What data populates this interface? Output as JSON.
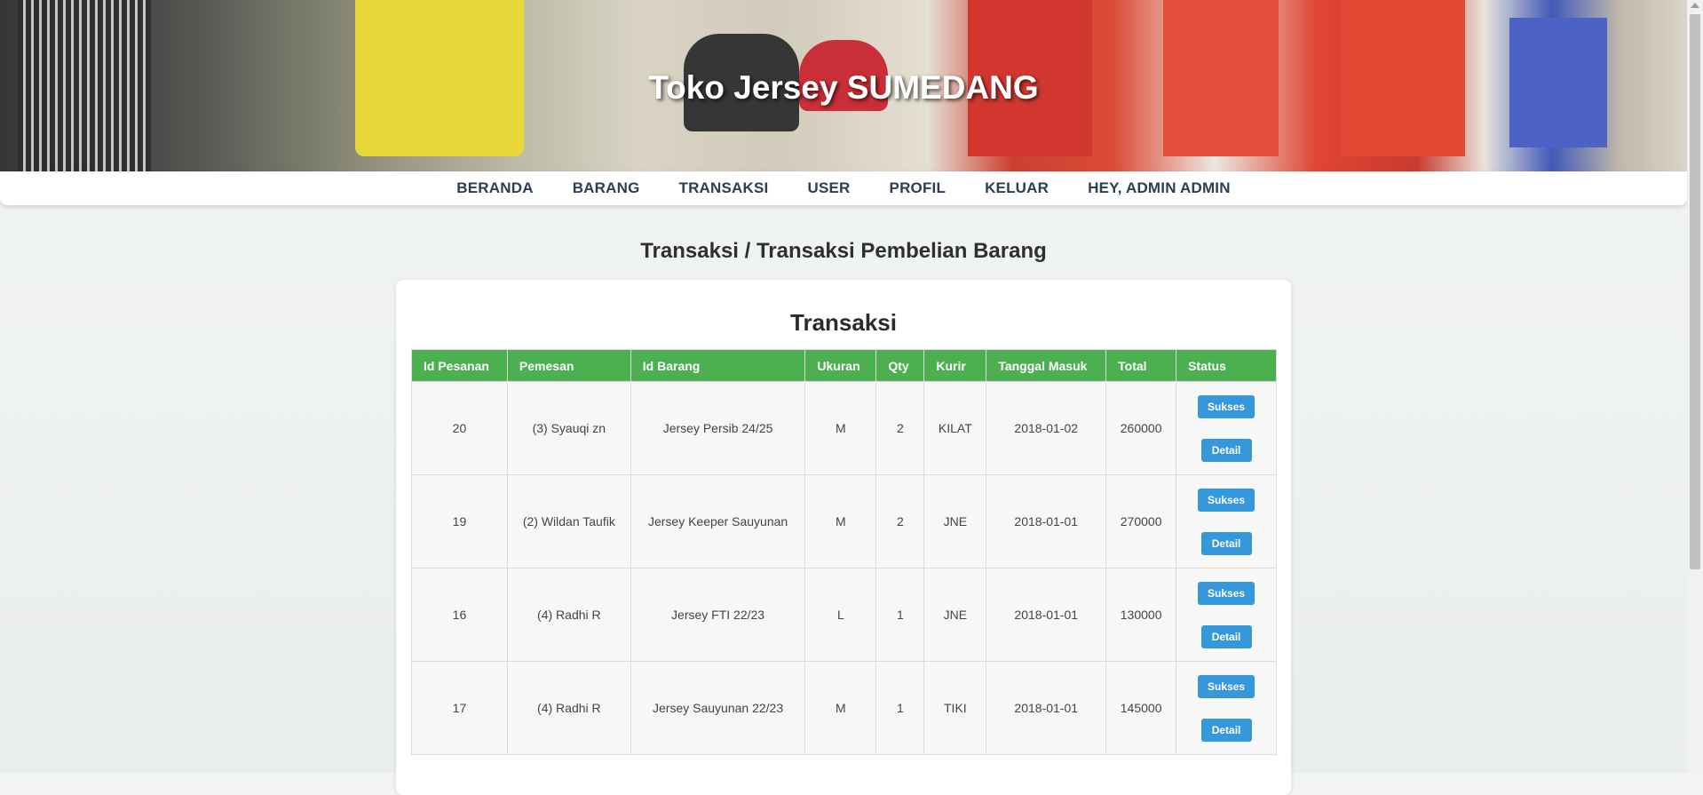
{
  "hero": {
    "title": "Toko Jersey SUMEDANG"
  },
  "nav": {
    "items": [
      "BERANDA",
      "BARANG",
      "TRANSAKSI",
      "USER",
      "PROFIL",
      "KELUAR",
      "HEY, ADMIN ADMIN"
    ]
  },
  "page": {
    "heading": "Transaksi / Transaksi Pembelian Barang"
  },
  "card": {
    "title": "Transaksi"
  },
  "table": {
    "headers": [
      "Id Pesanan",
      "Pemesan",
      "Id Barang",
      "Ukuran",
      "Qty",
      "Kurir",
      "Tanggal Masuk",
      "Total",
      "Status"
    ],
    "rows": [
      {
        "id": "20",
        "pemesan": "(3) Syauqi zn",
        "barang": "Jersey Persib 24/25",
        "ukuran": "M",
        "qty": "2",
        "kurir": "KILAT",
        "tanggal": "2018-01-02",
        "total": "260000",
        "status": "Sukses",
        "detail": "Detail"
      },
      {
        "id": "19",
        "pemesan": "(2) Wildan Taufik",
        "barang": "Jersey Keeper Sauyunan",
        "ukuran": "M",
        "qty": "2",
        "kurir": "JNE",
        "tanggal": "2018-01-01",
        "total": "270000",
        "status": "Sukses",
        "detail": "Detail"
      },
      {
        "id": "16",
        "pemesan": "(4) Radhi R",
        "barang": "Jersey FTI 22/23",
        "ukuran": "L",
        "qty": "1",
        "kurir": "JNE",
        "tanggal": "2018-01-01",
        "total": "130000",
        "status": "Sukses",
        "detail": "Detail"
      },
      {
        "id": "17",
        "pemesan": "(4) Radhi R",
        "barang": "Jersey Sauyunan 22/23",
        "ukuran": "M",
        "qty": "1",
        "kurir": "TIKI",
        "tanggal": "2018-01-01",
        "total": "145000",
        "status": "Sukses",
        "detail": "Detail"
      }
    ]
  },
  "colors": {
    "header_green": "#4caf50",
    "button_blue": "#3498db",
    "nav_text": "#2c3e50"
  }
}
